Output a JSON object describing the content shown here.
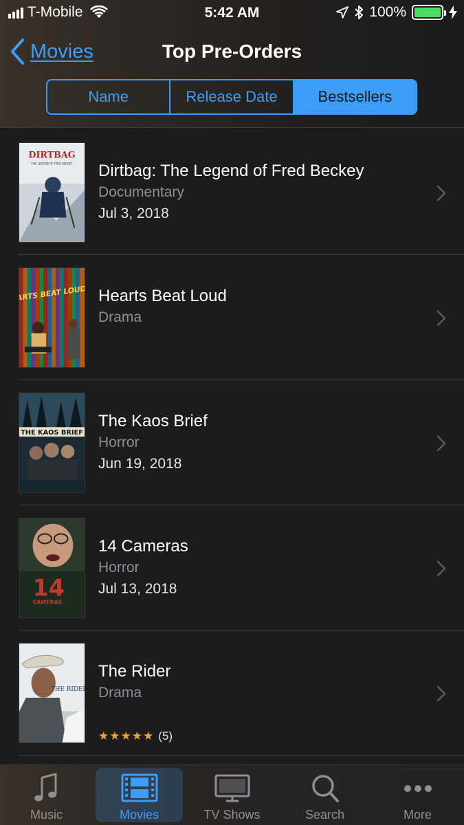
{
  "status_bar": {
    "carrier": "T-Mobile",
    "time": "5:42 AM",
    "battery": "100%",
    "battery_color": "#4cd964"
  },
  "nav": {
    "back_label": "Movies",
    "title": "Top Pre-Orders"
  },
  "segments": [
    {
      "label": "Name",
      "active": false
    },
    {
      "label": "Release Date",
      "active": false
    },
    {
      "label": "Bestsellers",
      "active": true
    }
  ],
  "items": [
    {
      "title": "Dirtbag: The Legend of Fred Beckey",
      "genre": "Documentary",
      "date": "Jul 3, 2018",
      "poster_text": "DIRTBAG",
      "poster_sub": "THE LEGEND OF FRED BECKEY"
    },
    {
      "title": "Hearts Beat Loud",
      "genre": "Drama",
      "date": "",
      "poster_text": "HEARTS BEAT LOUD"
    },
    {
      "title": "The Kaos Brief",
      "genre": "Horror",
      "date": "Jun 19, 2018",
      "poster_text": "THE KAOS BRIEF"
    },
    {
      "title": "14 Cameras",
      "genre": "Horror",
      "date": "Jul 13, 2018",
      "poster_text": "14",
      "poster_sub": "CAMERAS"
    },
    {
      "title": "The Rider",
      "genre": "Drama",
      "date": "",
      "poster_text": "THE RIDER",
      "stars": "★★★★★",
      "rating_count": "(5)"
    }
  ],
  "tabs": [
    {
      "label": "Music",
      "icon": "music-note-icon",
      "active": false
    },
    {
      "label": "Movies",
      "icon": "film-strip-icon",
      "active": true
    },
    {
      "label": "TV Shows",
      "icon": "tv-icon",
      "active": false
    },
    {
      "label": "Search",
      "icon": "search-icon",
      "active": false
    },
    {
      "label": "More",
      "icon": "more-dots-icon",
      "active": false
    }
  ],
  "colors": {
    "accent": "#3d9cf5",
    "star": "#f2a13a",
    "background": "#1c1c1c"
  }
}
